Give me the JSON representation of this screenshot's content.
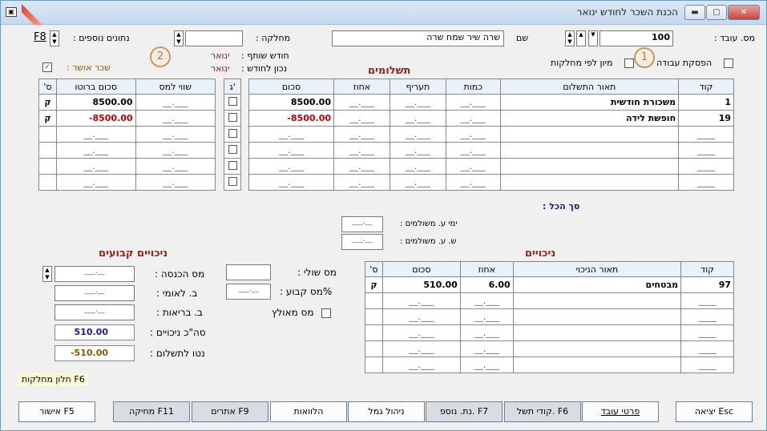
{
  "window": {
    "title": "הכנת השכר לחודש ינואר",
    "app_icon": "app-window-icon",
    "close": "✕",
    "max": "▢",
    "min": "▬"
  },
  "header": {
    "employee_no_label": "מס. עובד",
    "employee_no": "100",
    "name_label": "שם",
    "name_value": "שרה שיר שמח שרה",
    "department_label": "מחלקה",
    "department_value": "",
    "extra_data_label": "נתונים נוספים",
    "extra_data_value": "F8",
    "partner_month_label": "חודש שותף",
    "partner_month_value": "ינואר",
    "correct_month_label": "נכון לחודש",
    "correct_month_value": "ינואר",
    "approved_salary_label": "שכר אושר",
    "work_stop_label": "הפסקת עבודה",
    "sort_by_dept_label": "מיון לפי מחלקות",
    "badge_1": "1",
    "badge_2": "2"
  },
  "payments": {
    "title": "תשלומים",
    "columns": [
      "קוד",
      "תאור התשלום",
      "כמות",
      "תעריף",
      "אחוז",
      "סכום"
    ],
    "rows": [
      {
        "code": "1",
        "desc": "משכורת חודשית",
        "amount": "8500.00",
        "neg": false
      },
      {
        "code": "19",
        "desc": "חופשת לידה",
        "amount": "-8500.00",
        "neg": true
      }
    ]
  },
  "gross": {
    "columns": [
      "ג'",
      "שווי למס",
      "סכום ברוטו",
      "ס'"
    ],
    "rows": [
      {
        "gross": "8500.00",
        "flag": "ק",
        "neg": false
      },
      {
        "gross": "-8500.00",
        "flag": "ק",
        "neg": true
      }
    ]
  },
  "totals": {
    "total_label": "סך הכל",
    "paid_days_label": "ימי ע. משולמים",
    "paid_hours_label": "ש. ע. משולמים"
  },
  "deductions": {
    "title": "ניכויים",
    "columns": [
      "קוד",
      "תאור הניכוי",
      "אחוז",
      "סכום",
      "ס'"
    ],
    "rows": [
      {
        "code": "97",
        "desc": "מבטחים",
        "pct": "6.00",
        "amount": "510.00",
        "flag": "ק"
      }
    ]
  },
  "tax": {
    "marginal_label": "מס שולי",
    "fixed_pct_label": "%מס קבוע",
    "forced_label": "מס מאולץ"
  },
  "fixed_deductions": {
    "title": "ניכויים קבועים",
    "income_tax_label": "מס הכנסה",
    "national_ins_label": "ב. לאומי",
    "health_label": "ב. בריאות",
    "total_deductions_label": "סה\"כ ניכויים",
    "total_deductions_value": "510.00",
    "net_label": "נטו לתשלום",
    "net_value": "-510.00"
  },
  "dept_window_hint": "F6 חלון מחלקות",
  "placeholders": {
    "dash": "___.__"
  },
  "buttons": {
    "exit": "יציאה Esc",
    "employee_details": "פרטי עובד",
    "payment_codes": "קודי תשל. F6",
    "extra_data": "נת. נוספ. F7",
    "gemel": "ניהול גמל",
    "loans": "הלוואות",
    "alerts": "אתרים F9",
    "delete": "מחיקה F11",
    "approve": "אישור F5"
  },
  "colors": {
    "accent_red": "#a0201a",
    "blue": "#1a1aa0",
    "brown": "#8a5a00"
  }
}
